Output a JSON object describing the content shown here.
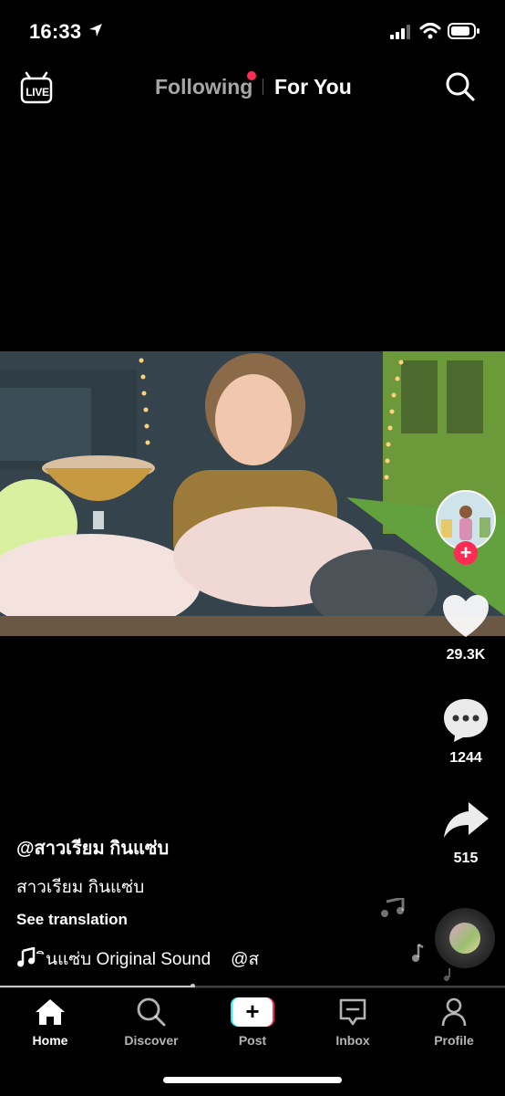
{
  "status_bar": {
    "time": "16:33",
    "icons": [
      "location-arrow-icon",
      "signal-icon",
      "wifi-icon",
      "battery-icon"
    ]
  },
  "top_nav": {
    "live_label": "LIVE",
    "tabs": [
      {
        "label": "Following",
        "active": false,
        "has_dot": true
      },
      {
        "label": "For You",
        "active": true
      }
    ],
    "search_icon": "search-icon",
    "dot_color": "#fe2c55"
  },
  "video": {
    "description": "food video thumbnail"
  },
  "right_rail": {
    "follow_plus": "+",
    "likes": "29.3K",
    "comments": "1244",
    "shares": "515"
  },
  "caption": {
    "username": "@สาวเรียม กินแซ่บ",
    "description": "สาวเรียม กินแซ่บ",
    "see_translation": "See translation",
    "sound": "ินแซ่บ Original Sound",
    "sound_trail": "@ส"
  },
  "progress": {
    "value": 0.38
  },
  "tab_bar": {
    "items": [
      {
        "label": "Home",
        "icon": "home-icon",
        "active": true
      },
      {
        "label": "Discover",
        "icon": "search-icon",
        "active": false
      },
      {
        "label": "Post",
        "icon": "plus-icon",
        "active": false
      },
      {
        "label": "Inbox",
        "icon": "inbox-icon",
        "active": false
      },
      {
        "label": "Profile",
        "icon": "profile-icon",
        "active": false
      }
    ]
  },
  "colors": {
    "accent": "#fe2c55",
    "cyan": "#25f4ee",
    "background": "#000000"
  }
}
